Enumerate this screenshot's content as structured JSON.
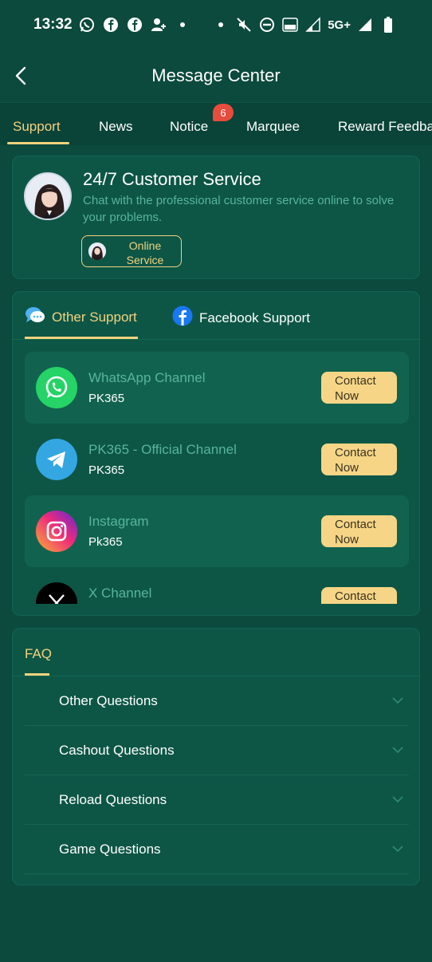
{
  "status_bar": {
    "time": "13:32",
    "network": "5G+"
  },
  "header": {
    "title": "Message Center"
  },
  "tabs": [
    {
      "label": "Support",
      "active": true
    },
    {
      "label": "News"
    },
    {
      "label": "Notice",
      "badge": "6"
    },
    {
      "label": "Marquee"
    },
    {
      "label": "Reward Feedba"
    }
  ],
  "customer_service": {
    "title": "24/7 Customer Service",
    "description": "Chat with the professional customer service online to solve your problems.",
    "online_button": "Online Service"
  },
  "support_tabs": [
    {
      "label": "Other Support",
      "icon": "chat-bubbles-icon",
      "active": true
    },
    {
      "label": "Facebook Support",
      "icon": "facebook-icon"
    }
  ],
  "channels": [
    {
      "name": "WhatsApp Channel",
      "sub": "PK365",
      "button": "Contact Now",
      "icon": "whatsapp-icon"
    },
    {
      "name": "PK365 - Official Channel",
      "sub": "PK365",
      "button": "Contact Now",
      "icon": "telegram-icon"
    },
    {
      "name": "Instagram",
      "sub": "Pk365",
      "button": "Contact Now",
      "icon": "instagram-icon"
    },
    {
      "name": "X Channel",
      "sub": "",
      "button": "Contact",
      "icon": "x-icon"
    }
  ],
  "faq": {
    "title": "FAQ",
    "items": [
      "Other Questions",
      "Cashout Questions",
      "Reload Questions",
      "Game Questions"
    ]
  },
  "colors": {
    "background": "#0b4a3d",
    "card": "#0d5646",
    "accent": "#f3d27e",
    "button": "#f6d586",
    "muted_text": "#58b49a",
    "badge": "#e74c3c"
  }
}
